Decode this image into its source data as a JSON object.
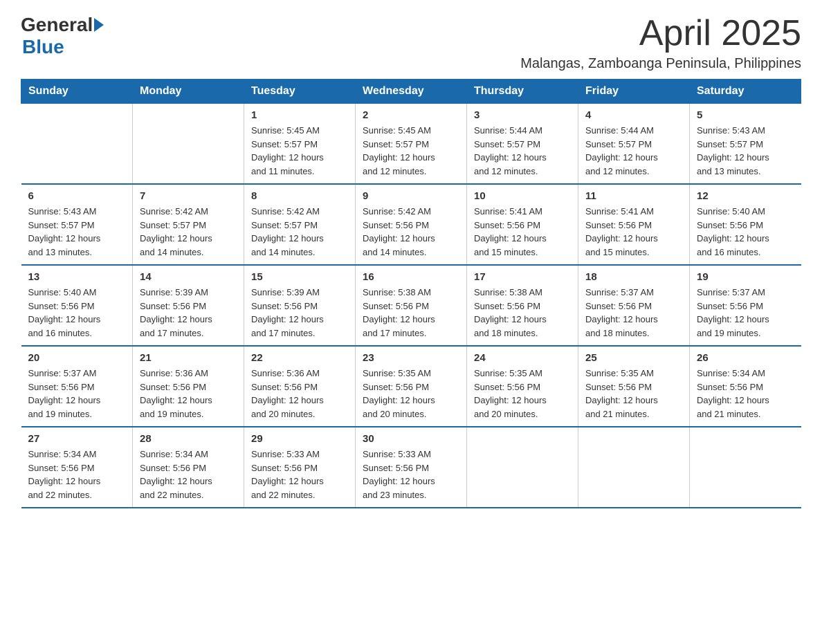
{
  "logo": {
    "general": "General",
    "blue": "Blue"
  },
  "header": {
    "month_year": "April 2025",
    "location": "Malangas, Zamboanga Peninsula, Philippines"
  },
  "weekdays": [
    "Sunday",
    "Monday",
    "Tuesday",
    "Wednesday",
    "Thursday",
    "Friday",
    "Saturday"
  ],
  "weeks": [
    [
      {
        "day": "",
        "info": ""
      },
      {
        "day": "",
        "info": ""
      },
      {
        "day": "1",
        "info": "Sunrise: 5:45 AM\nSunset: 5:57 PM\nDaylight: 12 hours\nand 11 minutes."
      },
      {
        "day": "2",
        "info": "Sunrise: 5:45 AM\nSunset: 5:57 PM\nDaylight: 12 hours\nand 12 minutes."
      },
      {
        "day": "3",
        "info": "Sunrise: 5:44 AM\nSunset: 5:57 PM\nDaylight: 12 hours\nand 12 minutes."
      },
      {
        "day": "4",
        "info": "Sunrise: 5:44 AM\nSunset: 5:57 PM\nDaylight: 12 hours\nand 12 minutes."
      },
      {
        "day": "5",
        "info": "Sunrise: 5:43 AM\nSunset: 5:57 PM\nDaylight: 12 hours\nand 13 minutes."
      }
    ],
    [
      {
        "day": "6",
        "info": "Sunrise: 5:43 AM\nSunset: 5:57 PM\nDaylight: 12 hours\nand 13 minutes."
      },
      {
        "day": "7",
        "info": "Sunrise: 5:42 AM\nSunset: 5:57 PM\nDaylight: 12 hours\nand 14 minutes."
      },
      {
        "day": "8",
        "info": "Sunrise: 5:42 AM\nSunset: 5:57 PM\nDaylight: 12 hours\nand 14 minutes."
      },
      {
        "day": "9",
        "info": "Sunrise: 5:42 AM\nSunset: 5:56 PM\nDaylight: 12 hours\nand 14 minutes."
      },
      {
        "day": "10",
        "info": "Sunrise: 5:41 AM\nSunset: 5:56 PM\nDaylight: 12 hours\nand 15 minutes."
      },
      {
        "day": "11",
        "info": "Sunrise: 5:41 AM\nSunset: 5:56 PM\nDaylight: 12 hours\nand 15 minutes."
      },
      {
        "day": "12",
        "info": "Sunrise: 5:40 AM\nSunset: 5:56 PM\nDaylight: 12 hours\nand 16 minutes."
      }
    ],
    [
      {
        "day": "13",
        "info": "Sunrise: 5:40 AM\nSunset: 5:56 PM\nDaylight: 12 hours\nand 16 minutes."
      },
      {
        "day": "14",
        "info": "Sunrise: 5:39 AM\nSunset: 5:56 PM\nDaylight: 12 hours\nand 17 minutes."
      },
      {
        "day": "15",
        "info": "Sunrise: 5:39 AM\nSunset: 5:56 PM\nDaylight: 12 hours\nand 17 minutes."
      },
      {
        "day": "16",
        "info": "Sunrise: 5:38 AM\nSunset: 5:56 PM\nDaylight: 12 hours\nand 17 minutes."
      },
      {
        "day": "17",
        "info": "Sunrise: 5:38 AM\nSunset: 5:56 PM\nDaylight: 12 hours\nand 18 minutes."
      },
      {
        "day": "18",
        "info": "Sunrise: 5:37 AM\nSunset: 5:56 PM\nDaylight: 12 hours\nand 18 minutes."
      },
      {
        "day": "19",
        "info": "Sunrise: 5:37 AM\nSunset: 5:56 PM\nDaylight: 12 hours\nand 19 minutes."
      }
    ],
    [
      {
        "day": "20",
        "info": "Sunrise: 5:37 AM\nSunset: 5:56 PM\nDaylight: 12 hours\nand 19 minutes."
      },
      {
        "day": "21",
        "info": "Sunrise: 5:36 AM\nSunset: 5:56 PM\nDaylight: 12 hours\nand 19 minutes."
      },
      {
        "day": "22",
        "info": "Sunrise: 5:36 AM\nSunset: 5:56 PM\nDaylight: 12 hours\nand 20 minutes."
      },
      {
        "day": "23",
        "info": "Sunrise: 5:35 AM\nSunset: 5:56 PM\nDaylight: 12 hours\nand 20 minutes."
      },
      {
        "day": "24",
        "info": "Sunrise: 5:35 AM\nSunset: 5:56 PM\nDaylight: 12 hours\nand 20 minutes."
      },
      {
        "day": "25",
        "info": "Sunrise: 5:35 AM\nSunset: 5:56 PM\nDaylight: 12 hours\nand 21 minutes."
      },
      {
        "day": "26",
        "info": "Sunrise: 5:34 AM\nSunset: 5:56 PM\nDaylight: 12 hours\nand 21 minutes."
      }
    ],
    [
      {
        "day": "27",
        "info": "Sunrise: 5:34 AM\nSunset: 5:56 PM\nDaylight: 12 hours\nand 22 minutes."
      },
      {
        "day": "28",
        "info": "Sunrise: 5:34 AM\nSunset: 5:56 PM\nDaylight: 12 hours\nand 22 minutes."
      },
      {
        "day": "29",
        "info": "Sunrise: 5:33 AM\nSunset: 5:56 PM\nDaylight: 12 hours\nand 22 minutes."
      },
      {
        "day": "30",
        "info": "Sunrise: 5:33 AM\nSunset: 5:56 PM\nDaylight: 12 hours\nand 23 minutes."
      },
      {
        "day": "",
        "info": ""
      },
      {
        "day": "",
        "info": ""
      },
      {
        "day": "",
        "info": ""
      }
    ]
  ]
}
